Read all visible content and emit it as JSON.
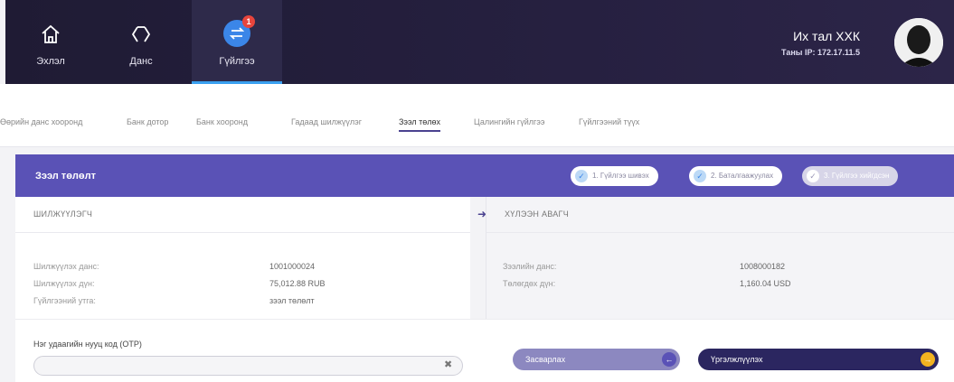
{
  "header": {
    "nav": [
      {
        "label": "Эхлэл",
        "icon": "home-icon"
      },
      {
        "label": "Данс",
        "icon": "accounts-icon"
      },
      {
        "label": "Гүйлгээ",
        "icon": "transfer-icon",
        "badge": "1"
      }
    ],
    "user": {
      "name": "Их тал ХХК",
      "ip": "Таны IP: 172.17.11.5"
    }
  },
  "tabs": [
    "Өөрийн данс хооронд",
    "Банк дотор",
    "Банк хооронд",
    "Гадаад шилжүүлэг",
    "Зээл төлөх",
    "Цалингийн гүйлгээ",
    "Гүйлгээний түүх"
  ],
  "section": {
    "title": "Зээл төлөлт",
    "steps": [
      "1. Гүйлгээ шивэх",
      "2. Баталгаажуулах",
      "3. Гүйлгээ хийгдсэн"
    ]
  },
  "sender": {
    "header": "ШИЛЖҮҮЛЭГЧ",
    "rows": [
      {
        "label": "Шилжүүлэх данс:",
        "value": "1001000024"
      },
      {
        "label": "Шилжүүлэх дүн:",
        "value": "75,012.88 RUB"
      },
      {
        "label": "Гүйлгээний утга:",
        "value": "зээл төлөлт"
      }
    ]
  },
  "receiver": {
    "header": "ХҮЛЭЭН АВАГЧ",
    "rows": [
      {
        "label": "Зээлийн данс:",
        "value": "1008000182"
      },
      {
        "label": "Төлөгдөх дүн:",
        "value": "1,160.04 USD"
      }
    ]
  },
  "otp": {
    "label": "Нэг удаагийн нууц код (OTP)",
    "value": ""
  },
  "buttons": {
    "edit": "Засварлах",
    "next": "Үргэлжлүүлэх"
  },
  "colors": {
    "header": "#231e3a",
    "accent": "#5a52b6",
    "active_tab_underline": "#3aa0f0",
    "next_button": "#2b2660",
    "next_arrow": "#f2b320"
  }
}
